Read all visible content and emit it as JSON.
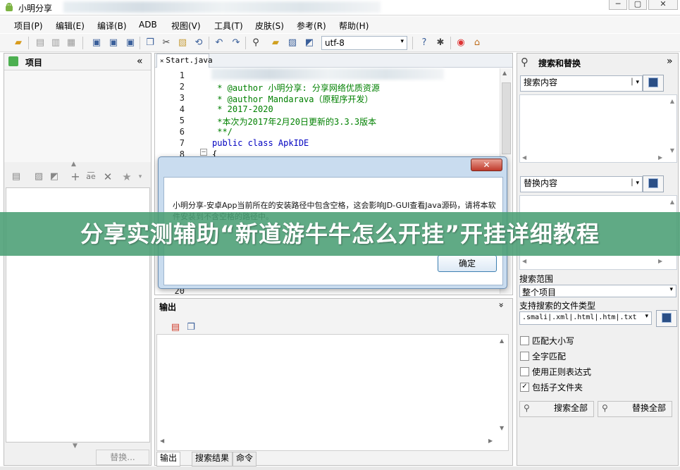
{
  "window": {
    "title": "小明分享"
  },
  "menu": [
    "项目(P)",
    "编辑(E)",
    "编译(B)",
    "ADB",
    "视图(V)",
    "工具(T)",
    "皮肤(S)",
    "参考(R)",
    "帮助(H)"
  ],
  "toolbar": {
    "encoding": "utf-8"
  },
  "left_panel": {
    "title": "项目",
    "collapse_glyph": "«",
    "replace_button": "替换..."
  },
  "editor": {
    "tab": "Start.java",
    "lines": [
      {
        "n": "1",
        "text": "",
        "cls": ""
      },
      {
        "n": "2",
        "text": " * @author 小明分享: 分享网络优质资源",
        "cls": "cmt"
      },
      {
        "n": "3",
        "text": " * @author Mandarava（原程序开发）",
        "cls": "cmt"
      },
      {
        "n": "4",
        "text": " * 2017-2020",
        "cls": "cmt"
      },
      {
        "n": "5",
        "text": " *本次为2017年2月20日更新的3.3.3版本",
        "cls": "cmt"
      },
      {
        "n": "6",
        "text": " **/",
        "cls": "cmt"
      },
      {
        "n": "7",
        "text": "public class ApkIDE",
        "cls": "kw"
      },
      {
        "n": "8",
        "text": "{",
        "cls": ""
      }
    ],
    "last_line": "20"
  },
  "dialog": {
    "close_label": "✕",
    "message": "小明分享-安卓App当前所在的安装路径中包含空格，这会影响JD-GUI查看Java源码，请将本软件安装到不含空格的路径中。",
    "ok_label": "确定"
  },
  "output": {
    "title": "输出",
    "toggle": "»",
    "tabs": [
      "输出",
      "搜索结果",
      "命令"
    ]
  },
  "right_panel": {
    "title": "搜索和替换",
    "expand_glyph": "»",
    "search_placeholder": "搜索内容",
    "replace_placeholder": "替换内容",
    "scope_label": "搜索范围",
    "scope_value": "整个项目",
    "filetypes_label": "支持搜索的文件类型",
    "filetypes_value": ".smali|.xml|.html|.htm|.txt",
    "options": [
      {
        "label": "匹配大小写",
        "checked": false
      },
      {
        "label": "全字匹配",
        "checked": false
      },
      {
        "label": "使用正则表达式",
        "checked": false
      },
      {
        "label": "包括子文件夹",
        "checked": true
      }
    ],
    "search_all": "搜索全部",
    "replace_all": "替换全部"
  },
  "banner": {
    "text": "分享实测辅助“新道游牛牛怎么开挂”开挂详细教程"
  }
}
